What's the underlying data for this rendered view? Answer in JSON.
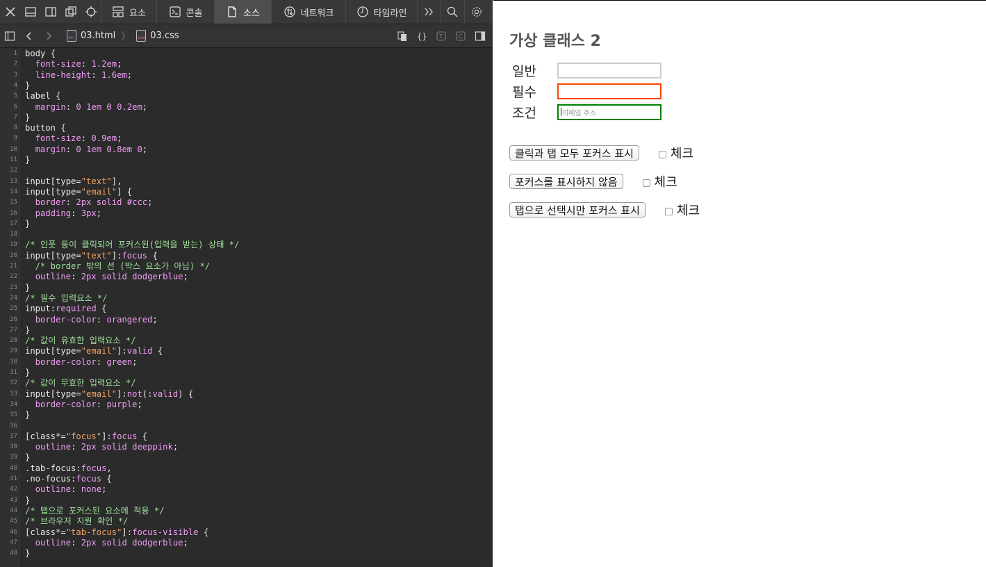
{
  "devtools": {
    "tabs": [
      {
        "label": "요소",
        "icon": "elements-icon"
      },
      {
        "label": "콘솔",
        "icon": "console-icon"
      },
      {
        "label": "소스",
        "icon": "sources-icon",
        "active": true
      },
      {
        "label": "네트워크",
        "icon": "network-icon"
      },
      {
        "label": "타임라인",
        "icon": "timeline-icon"
      }
    ],
    "breadcrumb": {
      "html_file": "03.html",
      "css_file": "03.css",
      "html_tag": "<>",
      "css_tag": "css"
    },
    "code_lines": [
      "body {",
      "  font-size: 1.2em;",
      "  line-height: 1.6em;",
      "}",
      "label {",
      "  margin: 0 1em 0 0.2em;",
      "}",
      "button {",
      "  font-size: 0.9em;",
      "  margin: 0 1em 0.8em 0;",
      "}",
      "",
      "input[type=\"text\"],",
      "input[type=\"email\"] {",
      "  border: 2px solid #ccc;",
      "  padding: 3px;",
      "}",
      "",
      "/* 인풋 등이 클릭되어 포커스된(입력을 받는) 상태 */",
      "input[type=\"text\"]:focus {",
      "  /* border 밖의 선 (박스 요소가 아님) */",
      "  outline: 2px solid dodgerblue;",
      "}",
      "/* 필수 입력요소 */",
      "input:required {",
      "  border-color: orangered;",
      "}",
      "/* 값이 유효한 입력요소 */",
      "input[type=\"email\"]:valid {",
      "  border-color: green;",
      "}",
      "/* 값이 무효한 입력요소 */",
      "input[type=\"email\"]:not(:valid) {",
      "  border-color: purple;",
      "}",
      "",
      "[class*=\"focus\"]:focus {",
      "  outline: 2px solid deeppink;",
      "}",
      ".tab-focus:focus,",
      ".no-focus:focus {",
      "  outline: none;",
      "}",
      "/* 탭으로 포커스된 요소에 적용 */",
      "/* 브라우저 지원 확인 */",
      "[class*=\"tab-focus\"]:focus-visible {",
      "  outline: 2px solid dodgerblue;",
      "}"
    ]
  },
  "page": {
    "title": "가상 클래스 2",
    "fields": [
      {
        "label": "일반",
        "value": "",
        "placeholder": "",
        "state": "normal"
      },
      {
        "label": "필수",
        "value": "",
        "placeholder": "",
        "state": "required"
      },
      {
        "label": "조건",
        "value": "",
        "placeholder": "이메일 주소",
        "state": "valid"
      }
    ],
    "buttons": [
      {
        "label": "클릭과 탭 모두 포커스 표시",
        "check_label": "체크"
      },
      {
        "label": "포커스를 표시하지 않음",
        "check_label": "체크"
      },
      {
        "label": "탭으로 선택시만 포커스 표시",
        "check_label": "체크"
      }
    ]
  },
  "colors": {
    "required_border": "#ff4500",
    "valid_border": "#008000",
    "default_border": "#cccccc",
    "devtools_bg": "#2b2b2b"
  }
}
